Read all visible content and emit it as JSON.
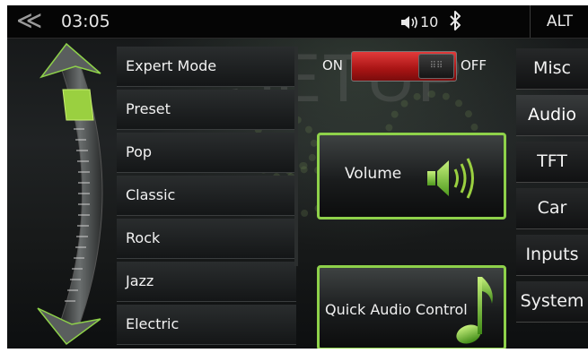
{
  "status_bar": {
    "back_glyph": "≪",
    "time": "03:05",
    "volume_level": "10",
    "alt_label": "ALT"
  },
  "watermark": "SETUP",
  "expert_mode": {
    "label": "Expert Mode",
    "on_label": "ON",
    "off_label": "OFF",
    "state": "on"
  },
  "presets": [
    {
      "label": "Preset"
    },
    {
      "label": "Pop"
    },
    {
      "label": "Classic"
    },
    {
      "label": "Rock"
    },
    {
      "label": "Jazz"
    },
    {
      "label": "Electric"
    }
  ],
  "buttons": {
    "volume": {
      "label": "Volume",
      "icon": "speaker-icon"
    },
    "quick_audio": {
      "label": "Quick Audio Control",
      "icon": "music-note-icon"
    }
  },
  "tabs": [
    {
      "label": "Misc",
      "active": false
    },
    {
      "label": "Audio",
      "active": true
    },
    {
      "label": "TFT",
      "active": false
    },
    {
      "label": "Car",
      "active": false
    },
    {
      "label": "Inputs",
      "active": false
    },
    {
      "label": "System",
      "active": false
    }
  ],
  "colors": {
    "accent": "#8ed14a",
    "toggle_on": "#c81e1e",
    "background": "#1a1c1d"
  }
}
